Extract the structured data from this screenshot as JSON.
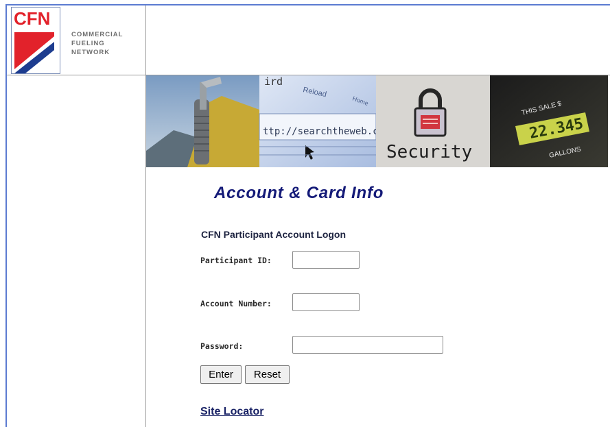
{
  "logo": {
    "mark_text": "CFN",
    "brand_lines": [
      "COMMERCIAL",
      "FUELING",
      "NETWORK"
    ],
    "colors": {
      "red": "#e2222b",
      "blue": "#1d3c8f"
    }
  },
  "banner": {
    "browser_texts": [
      "ird",
      "Reload",
      "Home",
      "ttp://searchtheweb.co"
    ],
    "security_label": "Security",
    "pump_texts": [
      "THIS SALE $",
      "22.345",
      "GALLONS"
    ],
    "icons": [
      "truck-photo",
      "browser-url-bar",
      "lock-icon",
      "fuel-pump-display"
    ]
  },
  "page": {
    "title": "Account & Card Info"
  },
  "form": {
    "heading": "CFN Participant Account Logon",
    "participant_id_label": "Participant ID:",
    "participant_id_value": "",
    "account_number_label": "Account Number:",
    "account_number_value": "",
    "password_label": "Password:",
    "password_value": "",
    "enter_label": "Enter",
    "reset_label": "Reset"
  },
  "links": {
    "site_locator": "Site Locator"
  },
  "colors": {
    "frame": "#5b7bd1",
    "title": "#141a78",
    "link": "#1a2366"
  }
}
